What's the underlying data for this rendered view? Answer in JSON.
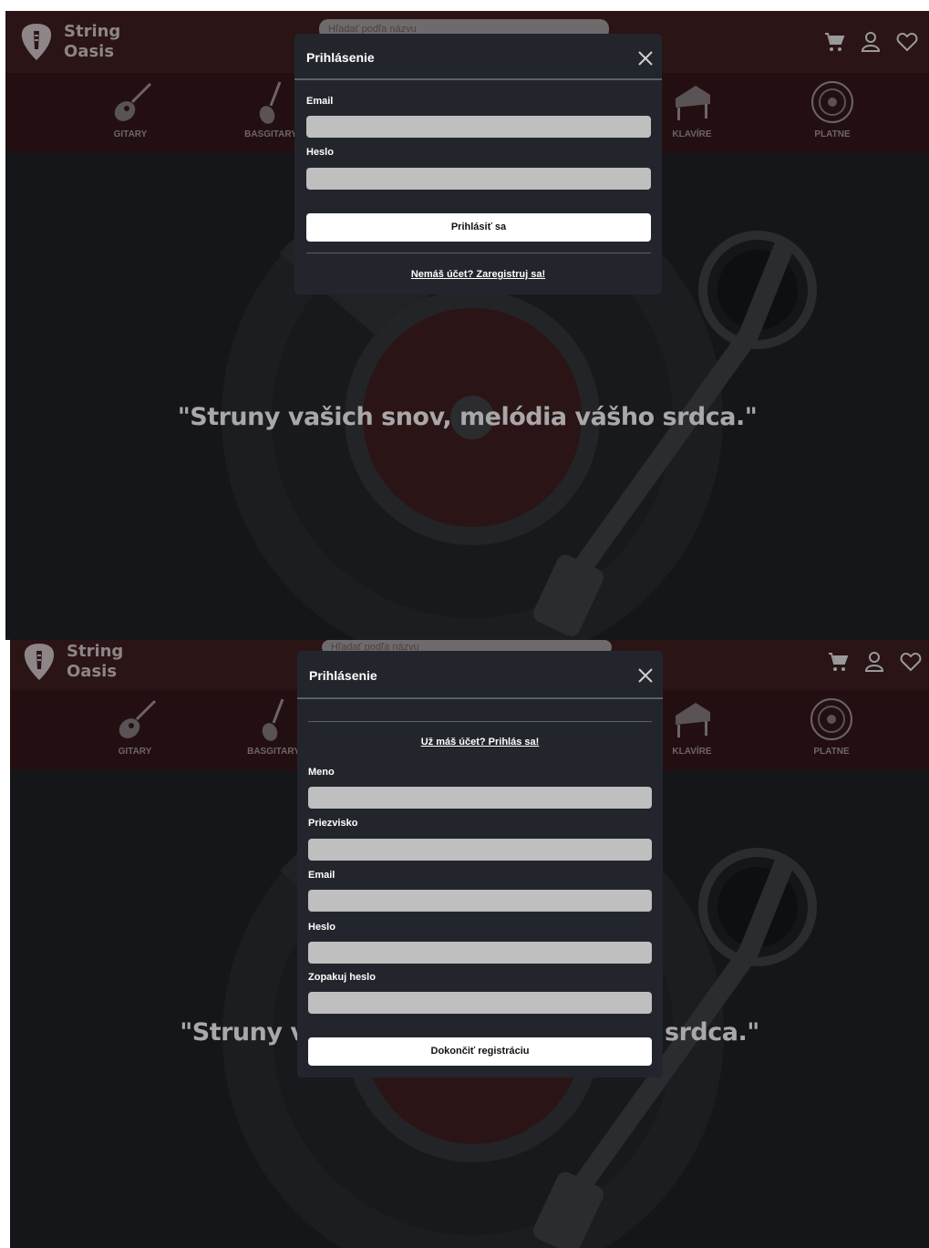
{
  "brand": {
    "line1": "String",
    "line2": "Oasis"
  },
  "search": {
    "placeholder": "Hľadať podľa názvu"
  },
  "header_icons": [
    "cart-icon",
    "user-icon",
    "heart-icon"
  ],
  "categories": [
    {
      "label": "GITARY",
      "icon": "guitar-icon"
    },
    {
      "label": "BASGITARY",
      "icon": "bass-guitar-icon"
    },
    {
      "label": "KLAVÍRE",
      "icon": "piano-icon"
    },
    {
      "label": "PLATNE",
      "icon": "vinyl-record-icon"
    }
  ],
  "hero": {
    "quote": "\"Struny vašich snov, melódia vášho srdca.\""
  },
  "login_modal": {
    "title": "Prihlásenie",
    "email_label": "Email",
    "password_label": "Heslo",
    "submit": "Prihlásiť sa",
    "register_link": "Nemáš účet? Zaregistruj sa!"
  },
  "register_modal": {
    "title": "Prihlásenie",
    "login_link": "Už máš účet? Prihlás sa!",
    "name_label": "Meno",
    "surname_label": "Priezvisko",
    "email_label": "Email",
    "password_label": "Heslo",
    "repeat_password_label": "Zopakuj heslo",
    "submit": "Dokončiť registráciu"
  },
  "colors": {
    "header_bg": "#2a1416",
    "category_bar_bg": "#230f12",
    "page_bg": "#141619",
    "modal_bg": "#22262c",
    "input_bg": "#bfbfc0",
    "button_bg": "#ffffff"
  }
}
